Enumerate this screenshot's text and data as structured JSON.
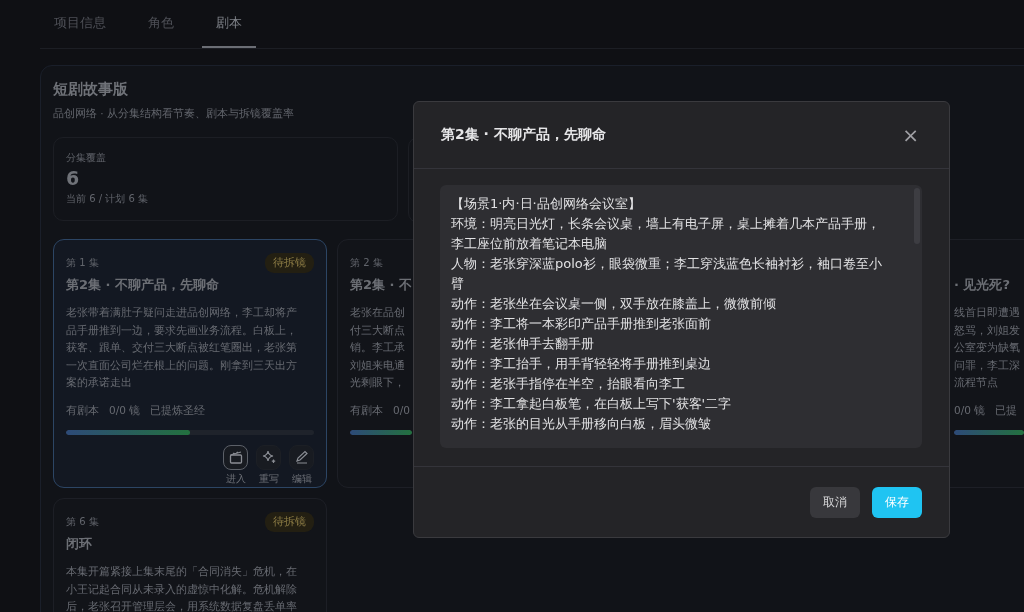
{
  "tabs": [
    {
      "label": "项目信息",
      "selected": false
    },
    {
      "label": "角色",
      "selected": false
    },
    {
      "label": "剧本",
      "selected": true
    }
  ],
  "board": {
    "title": "短剧故事版",
    "subtitle": "品创网络 · 从分集结构看节奏、剧本与拆镜覆盖率",
    "stats": [
      {
        "label": "分集覆盖",
        "value": "6",
        "note": "当前 6 / 计划 6 集"
      }
    ],
    "episodes": [
      {
        "number": "第 1 集",
        "badge": "待拆镜",
        "title": "第2集 · 不聊产品，先聊命",
        "selected": true,
        "desc_lines": [
          "老张带着满肚子疑问走进品创网络，李工却将产",
          "品手册推到一边，要求先画业务流程。白板上，",
          "获客、跟单、交付三大断点被红笔圈出，老张第",
          "一次直面公司烂在根上的问题。刚拿到三天出方",
          "案的承诺走出"
        ],
        "meta": [
          "有剧本",
          "0/0 镜",
          "已提炼圣经"
        ],
        "level": 0.5,
        "actions": [
          {
            "kind": "enter",
            "label": "进入",
            "selected": true
          },
          {
            "kind": "rewrite",
            "label": "重写",
            "selected": false
          },
          {
            "kind": "edit",
            "label": "编辑",
            "selected": false
          }
        ]
      },
      {
        "number": "第 2 集",
        "title": "第2集 · 不",
        "selected": false,
        "desc_lines": [
          "老张在品创",
          "付三大断点",
          "销。李工承",
          "刘姐来电通",
          "光剩眼下，"
        ],
        "meta": [
          "有剧本",
          "0/0"
        ],
        "level": 1
      },
      {
        "title": "· 见光死?",
        "selected": false,
        "desc_lines": [
          "线首日即遭遇",
          "怒骂，刘姐发",
          "公室变为缺氧",
          "问罪，李工深",
          "流程节点"
        ],
        "meta": [
          "0/0 镜",
          "已提"
        ],
        "level": 1
      },
      {
        "number": "第 6 集",
        "badge": "待拆镜",
        "title": "闭环",
        "selected": false,
        "desc_lines": [
          "本集开篇紧接上集末尾的「合同消失」危机，在",
          "小王记起合同从未录入的虚惊中化解。危机解除",
          "后，老张召开管理层会，用系统数据复盘丢单率"
        ]
      }
    ]
  },
  "dialog": {
    "title": "第2集 · 不聊产品，先聊命",
    "close": "×",
    "script_lines": [
      "【场景1·内·日·品创网络会议室】",
      "环境：明亮日光灯，长条会议桌，墙上有电子屏，桌上摊着几本产品手册，李工座位前放着笔记本电脑",
      "人物：老张穿深蓝polo衫，眼袋微重；李工穿浅蓝色长袖衬衫，袖口卷至小臂",
      "动作：老张坐在会议桌一侧，双手放在膝盖上，微微前倾",
      "动作：李工将一本彩印产品手册推到老张面前",
      "动作：老张伸手去翻手册",
      "动作：李工抬手，用手背轻轻将手册推到桌边",
      "动作：老张手指停在半空，抬眼看向李工",
      "动作：李工拿起白板笔，在白板上写下'获客'二字",
      "动作：老张的目光从手册移向白板，眉头微皱"
    ],
    "buttons": [
      {
        "kind": "cancel",
        "label": "取消"
      },
      {
        "kind": "save",
        "label": "保存"
      }
    ]
  }
}
